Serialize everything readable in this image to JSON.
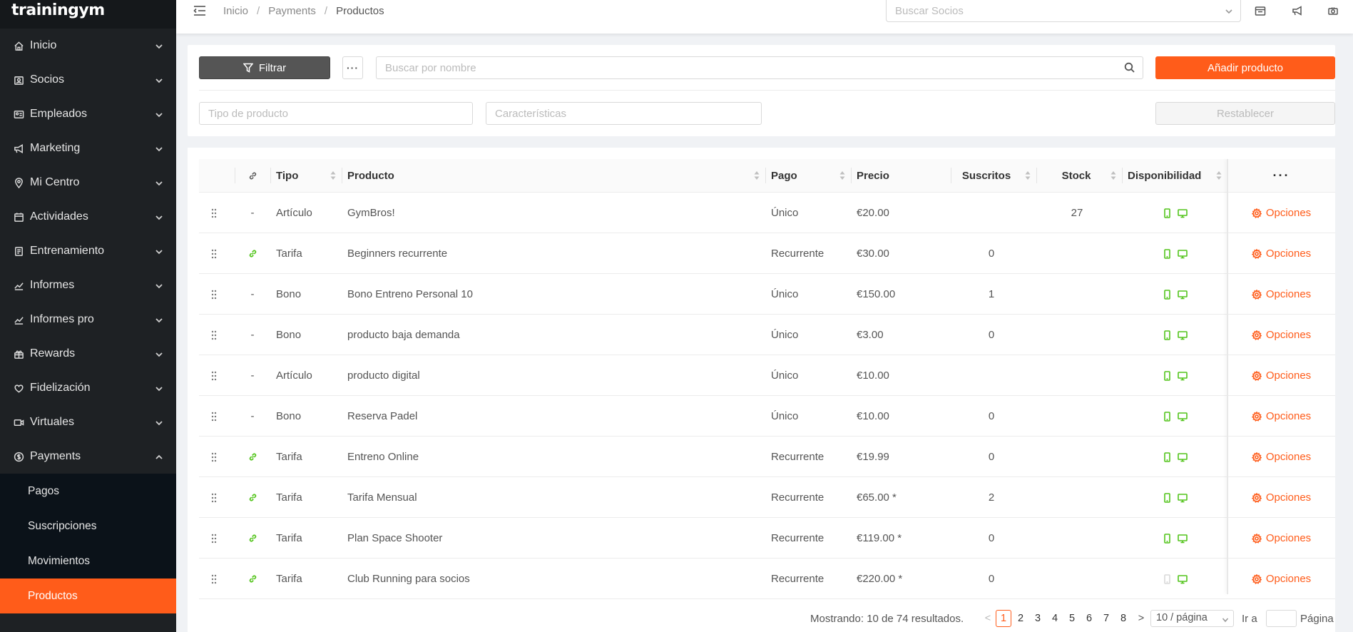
{
  "brand": "trainingym",
  "sidebar": {
    "items": [
      {
        "label": "Inicio",
        "icon": "home-icon"
      },
      {
        "label": "Socios",
        "icon": "members-icon"
      },
      {
        "label": "Empleados",
        "icon": "id-card-icon"
      },
      {
        "label": "Marketing",
        "icon": "megaphone-icon"
      },
      {
        "label": "Mi Centro",
        "icon": "location-icon"
      },
      {
        "label": "Actividades",
        "icon": "calendar-icon"
      },
      {
        "label": "Entrenamiento",
        "icon": "training-icon"
      },
      {
        "label": "Informes",
        "icon": "chart-line-icon"
      },
      {
        "label": "Informes pro",
        "icon": "chart-line-icon"
      },
      {
        "label": "Rewards",
        "icon": "gift-icon"
      },
      {
        "label": "Fidelización",
        "icon": "heart-icon"
      },
      {
        "label": "Virtuales",
        "icon": "video-icon"
      },
      {
        "label": "Payments",
        "icon": "dollar-circle-icon"
      }
    ],
    "payments_sub": [
      "Pagos",
      "Suscripciones",
      "Movimientos",
      "Productos"
    ]
  },
  "topbar": {
    "breadcrumb": [
      "Inicio",
      "Payments",
      "Productos"
    ],
    "member_search_placeholder": "Buscar Socios"
  },
  "filters": {
    "filter_label": "Filtrar",
    "more_label": "···",
    "search_placeholder": "Buscar por nombre",
    "add_label": "Añadir producto",
    "type_placeholder": "Tipo de producto",
    "features_placeholder": "Características",
    "reset_label": "Restablecer"
  },
  "table": {
    "headers": {
      "tipo": "Tipo",
      "producto": "Producto",
      "pago": "Pago",
      "precio": "Precio",
      "suscritos": "Suscritos",
      "stock": "Stock",
      "disponibilidad": "Disponibilidad",
      "actions": "···"
    },
    "options_label": "Opciones",
    "rows": [
      {
        "linked": false,
        "link": "-",
        "tipo": "Artículo",
        "producto": "GymBros!",
        "pago": "Único",
        "precio": "€20.00",
        "suscritos": "",
        "stock": "27",
        "mobile": true
      },
      {
        "linked": true,
        "link": "",
        "tipo": "Tarifa",
        "producto": "Beginners recurrente",
        "pago": "Recurrente",
        "precio": "€30.00",
        "suscritos": "0",
        "stock": "",
        "mobile": true
      },
      {
        "linked": false,
        "link": "-",
        "tipo": "Bono",
        "producto": "Bono Entreno Personal 10",
        "pago": "Único",
        "precio": "€150.00",
        "suscritos": "1",
        "stock": "",
        "mobile": true
      },
      {
        "linked": false,
        "link": "-",
        "tipo": "Bono",
        "producto": "producto baja demanda",
        "pago": "Único",
        "precio": "€3.00",
        "suscritos": "0",
        "stock": "",
        "mobile": true
      },
      {
        "linked": false,
        "link": "-",
        "tipo": "Artículo",
        "producto": "producto digital",
        "pago": "Único",
        "precio": "€10.00",
        "suscritos": "",
        "stock": "",
        "mobile": true
      },
      {
        "linked": false,
        "link": "-",
        "tipo": "Bono",
        "producto": "Reserva Padel",
        "pago": "Único",
        "precio": "€10.00",
        "suscritos": "0",
        "stock": "",
        "mobile": true
      },
      {
        "linked": true,
        "link": "",
        "tipo": "Tarifa",
        "producto": "Entreno Online",
        "pago": "Recurrente",
        "precio": "€19.99",
        "suscritos": "0",
        "stock": "",
        "mobile": true
      },
      {
        "linked": true,
        "link": "",
        "tipo": "Tarifa",
        "producto": "Tarifa Mensual",
        "pago": "Recurrente",
        "precio": "€65.00 *",
        "suscritos": "2",
        "stock": "",
        "mobile": true
      },
      {
        "linked": true,
        "link": "",
        "tipo": "Tarifa",
        "producto": "Plan Space Shooter",
        "pago": "Recurrente",
        "precio": "€119.00 *",
        "suscritos": "0",
        "stock": "",
        "mobile": true
      },
      {
        "linked": true,
        "link": "",
        "tipo": "Tarifa",
        "producto": "Club Running para socios",
        "pago": "Recurrente",
        "precio": "€220.00 *",
        "suscritos": "0",
        "stock": "",
        "mobile": false
      }
    ]
  },
  "pagination": {
    "summary": "Mostrando: 10 de 74 resultados.",
    "prev": "<",
    "pages": [
      "1",
      "2",
      "3",
      "4",
      "5",
      "6",
      "7",
      "8"
    ],
    "current": "1",
    "next": ">",
    "page_size": "10 / página",
    "goto_label": "Ir a",
    "page_label": "Página"
  },
  "colors": {
    "accent": "#ff5c1a",
    "available": "#52c41a",
    "unavailable": "#d9d9d9",
    "sidebar_bg": "#1e2124",
    "submenu_bg": "#0b1219"
  }
}
